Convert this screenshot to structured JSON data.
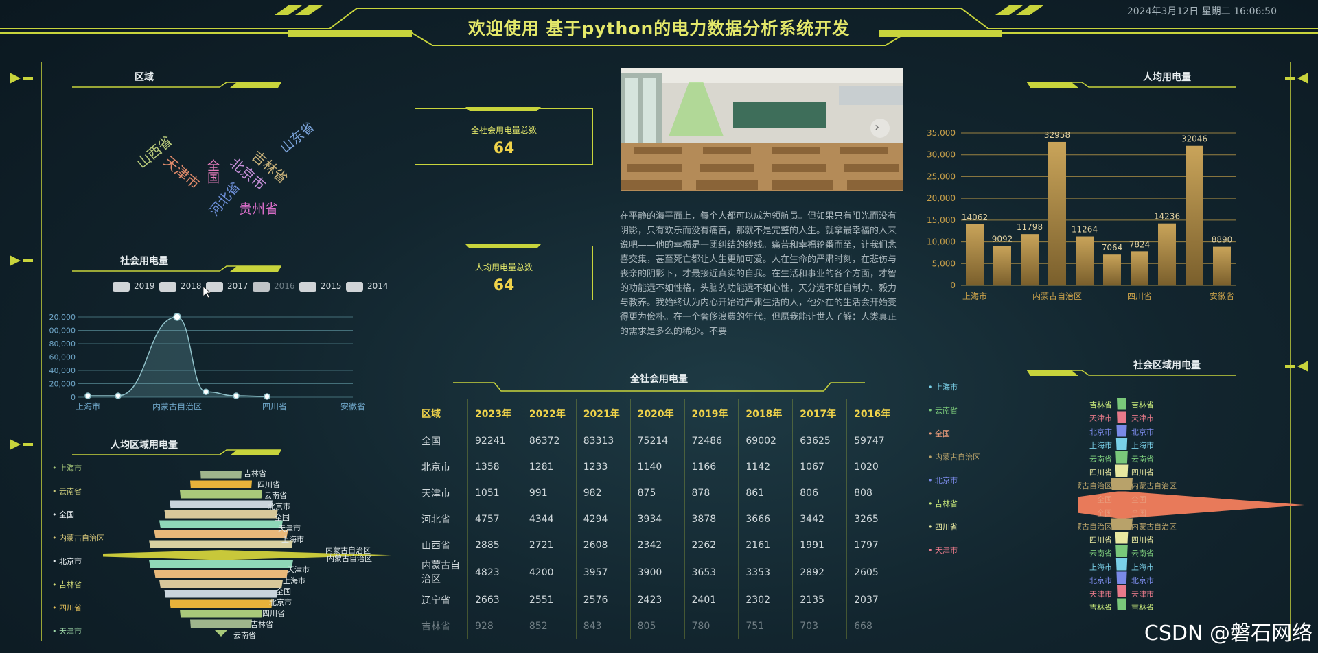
{
  "header": {
    "title": "欢迎使用 基于python的电力数据分析系统开发",
    "datetime": "2024年3月12日 星期二 16:06:50"
  },
  "panels": {
    "region": "区域",
    "social_power": "社会用电量",
    "per_capita_region": "人均区域用电量",
    "per_capita": "人均用电量",
    "social_region": "社会区域用电量",
    "national_power": "全社会用电量"
  },
  "kpi": {
    "total_label": "全社会用电量总数",
    "total_value": "64",
    "per_capita_label": "人均用电量总数",
    "per_capita_value": "64"
  },
  "wordcloud": [
    {
      "text": "山西省",
      "color": "#b7c97a"
    },
    {
      "text": "天津市",
      "color": "#e08a6a"
    },
    {
      "text": "全国",
      "color": "#e07ab8"
    },
    {
      "text": "河北省",
      "color": "#6d8fd8"
    },
    {
      "text": "北京市",
      "color": "#c58fd8"
    },
    {
      "text": "吉林省",
      "color": "#c9b27a"
    },
    {
      "text": "贵州省",
      "color": "#d86dc8"
    },
    {
      "text": "山东省",
      "color": "#7aa2d8"
    }
  ],
  "year_legend": [
    {
      "label": "2019",
      "active": true
    },
    {
      "label": "2018",
      "active": true
    },
    {
      "label": "2017",
      "active": true
    },
    {
      "label": "2016",
      "active": false
    },
    {
      "label": "2015",
      "active": true
    },
    {
      "label": "2014",
      "active": true
    }
  ],
  "left_funnel_legend": [
    {
      "label": "上海市",
      "color": "#a9c97a"
    },
    {
      "label": "云南省",
      "color": "#c9c97a"
    },
    {
      "label": "全国",
      "color": "#e8eef0"
    },
    {
      "label": "内蒙古自治区",
      "color": "#d8c87a"
    },
    {
      "label": "北京市",
      "color": "#e8eef0"
    },
    {
      "label": "吉林省",
      "color": "#d8e07a"
    },
    {
      "label": "四川省",
      "color": "#e8c35a"
    },
    {
      "label": "天津市",
      "color": "#9fd8a8"
    }
  ],
  "left_funnel_labels_top": [
    "吉林省",
    "四川省",
    "云南省",
    "北京市",
    "全国",
    "天津市",
    "上海市",
    "内蒙古自治区"
  ],
  "left_funnel_labels_bottom": [
    "内蒙古自治区",
    "天津市",
    "上海市",
    "全国",
    "北京市",
    "四川省",
    "吉林省",
    "云南省"
  ],
  "right_legend": [
    {
      "label": "上海市",
      "color": "#7ad0e8"
    },
    {
      "label": "云南省",
      "color": "#7ac87a"
    },
    {
      "label": "全国",
      "color": "#e89a7a"
    },
    {
      "label": "内蒙古自治区",
      "color": "#b8a26a"
    },
    {
      "label": "北京市",
      "color": "#7a8ae8"
    },
    {
      "label": "吉林省",
      "color": "#c8e87a"
    },
    {
      "label": "四川省",
      "color": "#e8e8a0"
    },
    {
      "label": "天津市",
      "color": "#e87a8a"
    }
  ],
  "right_funnel_labels": [
    "吉林省",
    "天津市",
    "北京市",
    "上海市",
    "云南省",
    "四川省",
    "内蒙古自治区",
    "全国",
    "全国",
    "内蒙古自治区",
    "四川省",
    "云南省",
    "上海市",
    "北京市",
    "天津市",
    "吉林省"
  ],
  "article": "在平静的海平面上，每个人都可以成为领航员。但如果只有阳光而没有阴影，只有欢乐而没有痛苦，那就不是完整的人生。就拿最幸福的人来说吧——他的幸福是一团纠结的纱线。痛苦和幸福轮番而至，让我们悲喜交集，甚至死亡都让人生更加可爱。人在生命的严肃时刻，在悲伤与丧亲的阴影下，才最接近真实的自我。在生活和事业的各个方面，才智的功能远不如性格，头脑的功能远不如心性，天分远不如自制力、毅力与教养。我始终认为内心开始过严肃生活的人，他外在的生活会开始变得更为俭朴。在一个奢侈浪费的年代，但愿我能让世人了解：人类真正的需求是多么的稀少。不要",
  "table": {
    "headers": [
      "区域",
      "2023年",
      "2022年",
      "2021年",
      "2020年",
      "2019年",
      "2018年",
      "2017年",
      "2016年"
    ],
    "rows": [
      [
        "全国",
        "92241",
        "86372",
        "83313",
        "75214",
        "72486",
        "69002",
        "63625",
        "59747"
      ],
      [
        "北京市",
        "1358",
        "1281",
        "1233",
        "1140",
        "1166",
        "1142",
        "1067",
        "1020"
      ],
      [
        "天津市",
        "1051",
        "991",
        "982",
        "875",
        "878",
        "861",
        "806",
        "808"
      ],
      [
        "河北省",
        "4757",
        "4344",
        "4294",
        "3934",
        "3878",
        "3666",
        "3442",
        "3265"
      ],
      [
        "山西省",
        "2885",
        "2721",
        "2608",
        "2342",
        "2262",
        "2161",
        "1991",
        "1797"
      ],
      [
        "内蒙古自治区",
        "4823",
        "4200",
        "3957",
        "3900",
        "3653",
        "3353",
        "2892",
        "2605"
      ],
      [
        "辽宁省",
        "2663",
        "2551",
        "2576",
        "2423",
        "2401",
        "2302",
        "2135",
        "2037"
      ],
      [
        "吉林省",
        "928",
        "852",
        "843",
        "805",
        "780",
        "751",
        "703",
        "668"
      ]
    ]
  },
  "chart_data": [
    {
      "type": "bar",
      "title": "人均用电量",
      "categories": [
        "上海市",
        "",
        "",
        "内蒙古自治区",
        "",
        "",
        "四川省",
        "",
        "",
        "安徽省"
      ],
      "values": [
        14062,
        9092,
        11798,
        32958,
        11264,
        7064,
        7824,
        14236,
        32046,
        8890
      ],
      "ylim": [
        0,
        35000
      ],
      "yticks": [
        "35,000",
        "30,000",
        "25,000",
        "20,000",
        "15,000",
        "10,000",
        "5,000",
        "0"
      ],
      "grid": true,
      "bar_color": "#c3a054"
    },
    {
      "type": "line",
      "title": "社会用电量",
      "x_ticks": [
        "上海市",
        "内蒙古自治区",
        "四川省",
        "安徽省"
      ],
      "y_ticks": [
        "20,000",
        "00,000",
        "80,000",
        "60,000",
        "40,000",
        "20,000",
        "0"
      ],
      "values": [
        2000,
        2000,
        120000,
        8000,
        2000,
        1000
      ],
      "ylim": [
        0,
        120000
      ],
      "grid": true
    },
    {
      "type": "funnel",
      "title": "人均区域用电量",
      "widths": [
        0.2,
        0.3,
        0.4,
        0.5,
        0.55,
        0.6,
        0.65,
        0.7,
        1.0,
        0.7,
        0.65,
        0.6,
        0.55,
        0.5,
        0.4,
        0.3,
        0.1
      ],
      "colors": [
        "#9fb58c",
        "#e8b23a",
        "#a9c97a",
        "#c9d4dc",
        "#d8c89a",
        "#8fd8b8",
        "#e8b87a",
        "#d8d0a0",
        "#c8c83a",
        "#8fd8b8",
        "#e8b87a",
        "#d8c89a",
        "#c9d4dc",
        "#e8b23a",
        "#a9c97a",
        "#9fb58c",
        "#a9c97a"
      ]
    },
    {
      "type": "funnel",
      "title": "社会区域用电量",
      "widths": [
        0.05,
        0.05,
        0.06,
        0.07,
        0.08,
        0.09,
        0.2,
        1.0,
        1.0,
        0.2,
        0.09,
        0.08,
        0.07,
        0.06,
        0.05,
        0.05
      ],
      "colors": [
        "#7ac87a",
        "#e87a8a",
        "#7a8ae8",
        "#7ad0e8",
        "#7ac87a",
        "#e8e8a0",
        "#b8a26a",
        "#e87a5a",
        "#e87a5a",
        "#b8a26a",
        "#e8e8a0",
        "#7ac87a",
        "#7ad0e8",
        "#7a8ae8",
        "#e87a8a",
        "#7ac87a"
      ]
    }
  ],
  "watermark": "CSDN @磐石网络"
}
